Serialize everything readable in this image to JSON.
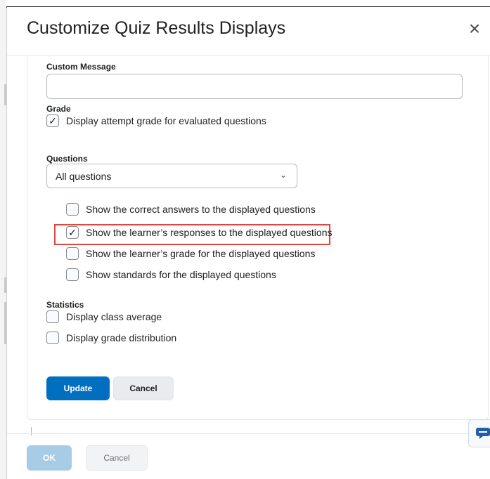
{
  "dialog": {
    "title": "Customize Quiz Results Displays",
    "close_glyph": "×"
  },
  "custom_message": {
    "label": "Custom Message",
    "value": "",
    "placeholder": ""
  },
  "grade": {
    "label": "Grade",
    "options": [
      {
        "label": "Display attempt grade for evaluated questions",
        "checked": true
      }
    ]
  },
  "questions": {
    "label": "Questions",
    "selected": "All questions",
    "options": [
      {
        "label": "Show the correct answers to the displayed questions",
        "checked": false
      },
      {
        "label": "Show the learner’s responses to the displayed questions",
        "checked": true,
        "highlighted": true
      },
      {
        "label": "Show the learner’s grade for the displayed questions",
        "checked": false
      },
      {
        "label": "Show standards for the displayed questions",
        "checked": false
      }
    ]
  },
  "statistics": {
    "label": "Statistics",
    "options": [
      {
        "label": "Display class average",
        "checked": false
      },
      {
        "label": "Display grade distribution",
        "checked": false
      }
    ]
  },
  "actions": {
    "update": "Update",
    "cancel": "Cancel"
  },
  "footer": {
    "ok": "OK",
    "cancel": "Cancel"
  },
  "colors": {
    "primary": "#006fbf",
    "highlight_box": "#e0473f",
    "disabled_primary": "#a8cbe6"
  }
}
